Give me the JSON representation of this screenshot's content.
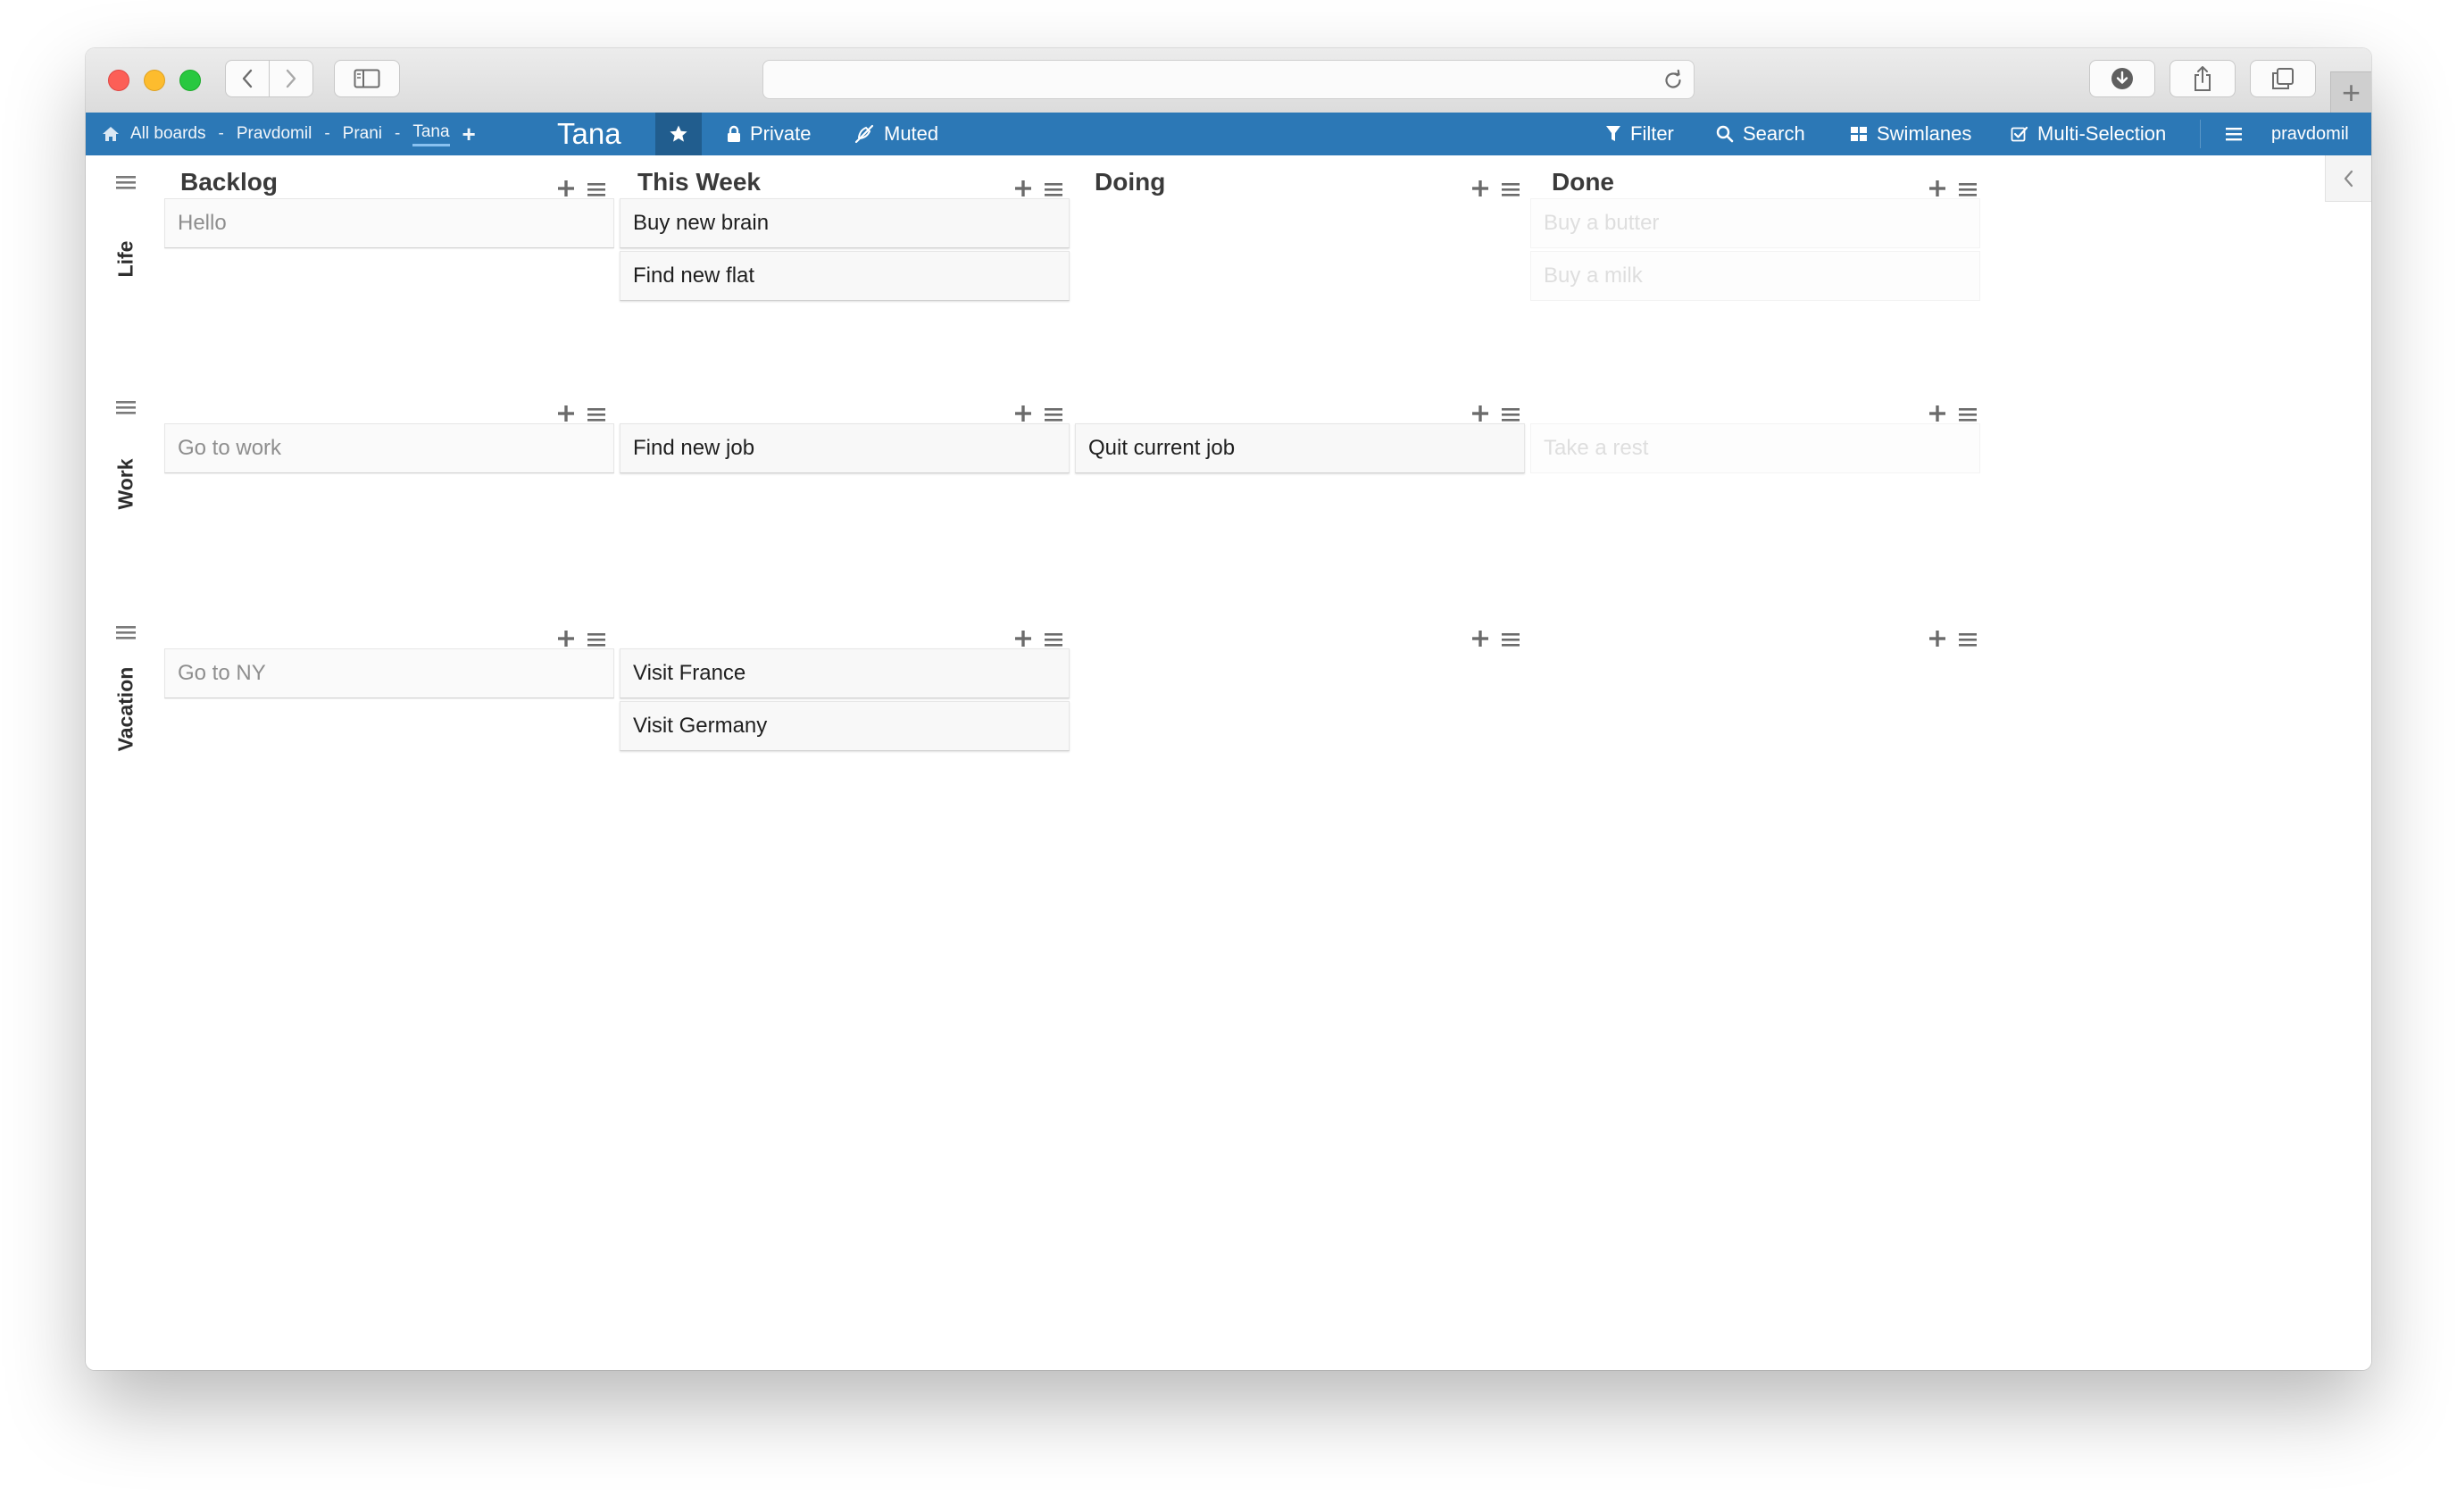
{
  "browser": {
    "url": "",
    "icons": {
      "back": "chevron-left-icon",
      "forward": "chevron-right-icon",
      "sidebar": "sidebar-icon",
      "reload": "reload-icon",
      "download": "download-icon",
      "share": "share-icon",
      "tabs": "tabs-icon",
      "new_tab": "+"
    }
  },
  "header": {
    "breadcrumbs": [
      "All boards",
      "Pravdomil",
      "Prani",
      "Tana"
    ],
    "separator": "-",
    "add_board": "+",
    "board_title": "Tana",
    "privacy": "Private",
    "watch": "Muted",
    "filter": "Filter",
    "search": "Search",
    "view": "Swimlanes",
    "multiselection": "Multi-Selection",
    "username": "pravdomil",
    "colors": {
      "bar": "#2c78b6",
      "star_box": "#215d8e"
    }
  },
  "lists": [
    "Backlog",
    "This Week",
    "Doing",
    "Done"
  ],
  "swimlanes": [
    {
      "title": "Life",
      "cards": [
        [
          "Hello"
        ],
        [
          "Buy new brain",
          "Find new flat"
        ],
        [],
        [
          "Buy a butter",
          "Buy a milk"
        ]
      ]
    },
    {
      "title": "Work",
      "cards": [
        [
          "Go to work"
        ],
        [
          "Find new job"
        ],
        [
          "Quit current job"
        ],
        [
          "Take a rest"
        ]
      ]
    },
    {
      "title": "Vacation",
      "cards": [
        [
          "Go to NY"
        ],
        [
          "Visit France",
          "Visit Germany"
        ],
        [],
        []
      ]
    }
  ]
}
